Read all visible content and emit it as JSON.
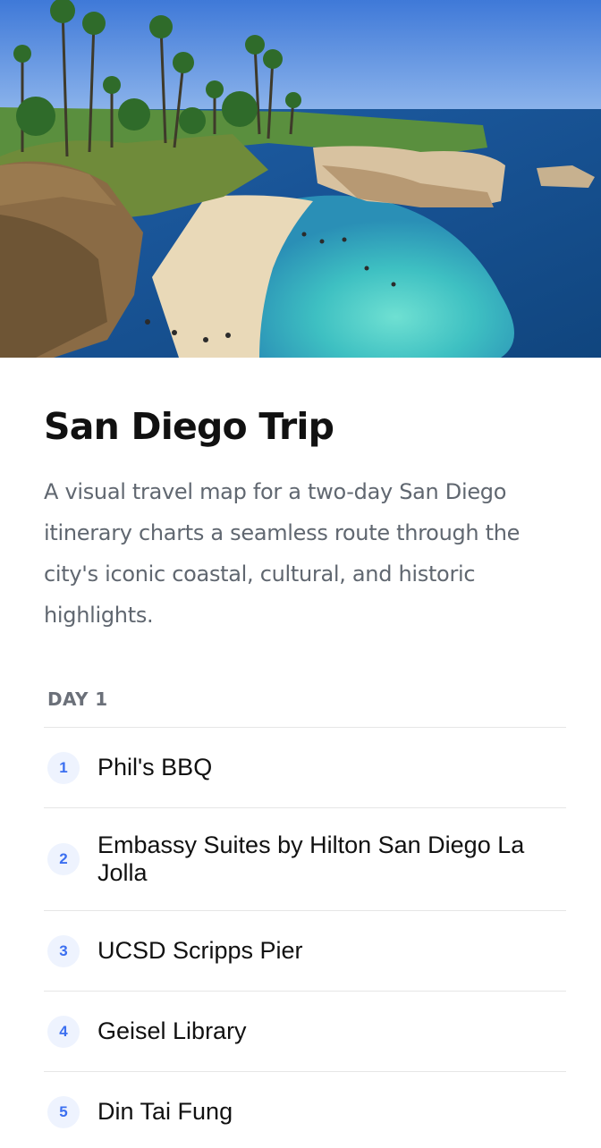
{
  "trip": {
    "title": "San Diego Trip",
    "description": "A visual travel map for a two-day San Diego itinerary charts a seamless route through the city's iconic coastal, cultural, and historic highlights."
  },
  "days": [
    {
      "label": "DAY 1",
      "stops": [
        {
          "number": "1",
          "name": "Phil's BBQ"
        },
        {
          "number": "2",
          "name": "Embassy Suites by Hilton San Diego La Jolla"
        },
        {
          "number": "3",
          "name": "UCSD Scripps Pier"
        },
        {
          "number": "4",
          "name": "Geisel Library"
        },
        {
          "number": "5",
          "name": "Din Tai Fung"
        }
      ]
    }
  ],
  "colors": {
    "number_badge_bg": "#eef3fe",
    "number_badge_text": "#3b6ff0",
    "divider": "#e6e6e6"
  }
}
